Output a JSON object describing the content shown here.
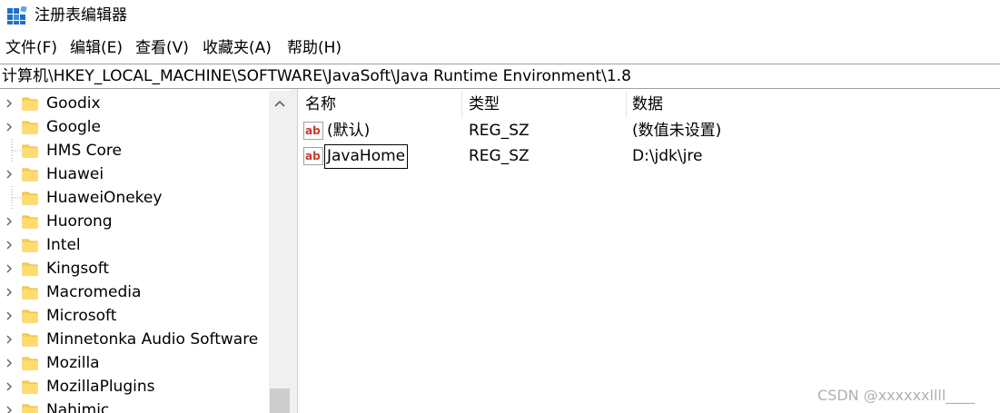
{
  "window": {
    "title": "注册表编辑器",
    "icon": "regedit-icon"
  },
  "menu": [
    "文件(F)",
    "编辑(E)",
    "查看(V)",
    "收藏夹(A)",
    "帮助(H)"
  ],
  "address": "计算机\\HKEY_LOCAL_MACHINE\\SOFTWARE\\JavaSoft\\Java Runtime Environment\\1.8",
  "tree": {
    "items": [
      {
        "label": "Goodix",
        "expandable": true
      },
      {
        "label": "Google",
        "expandable": true
      },
      {
        "label": "HMS Core",
        "expandable": false
      },
      {
        "label": "Huawei",
        "expandable": true
      },
      {
        "label": "HuaweiOnekey",
        "expandable": false
      },
      {
        "label": "Huorong",
        "expandable": true
      },
      {
        "label": "Intel",
        "expandable": true
      },
      {
        "label": "Kingsoft",
        "expandable": true
      },
      {
        "label": "Macromedia",
        "expandable": true
      },
      {
        "label": "Microsoft",
        "expandable": true
      },
      {
        "label": "Minnetonka Audio Software",
        "expandable": true
      },
      {
        "label": "Mozilla",
        "expandable": true
      },
      {
        "label": "MozillaPlugins",
        "expandable": true
      },
      {
        "label": "Nahimic",
        "expandable": true
      }
    ]
  },
  "values": {
    "columns": [
      "名称",
      "类型",
      "数据"
    ],
    "rows": [
      {
        "name": "(默认)",
        "type": "REG_SZ",
        "data": "(数值未设置)"
      },
      {
        "name": "JavaHome",
        "type": "REG_SZ",
        "data": "D:\\jdk\\jre"
      }
    ]
  },
  "watermark": "CSDN @xxxxxxllll____",
  "colors": {
    "folder": "#ffd04a",
    "folder_dark": "#e8b730",
    "ab_red": "#c8382c"
  }
}
